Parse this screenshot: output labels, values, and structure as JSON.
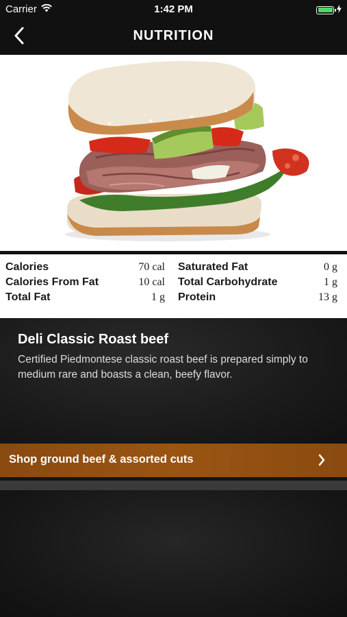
{
  "status_bar": {
    "carrier": "Carrier",
    "time": "1:42 PM",
    "battery_level": 1.0,
    "battery_color": "#4cd964"
  },
  "nav": {
    "back_icon": "chevron-left-icon",
    "title": "NUTRITION"
  },
  "hero": {
    "image_subject": "roast beef sandwich"
  },
  "nutrition": {
    "left": [
      {
        "label": "Calories",
        "value": "70 cal"
      },
      {
        "label": "Calories From Fat",
        "value": "10 cal"
      },
      {
        "label": "Total Fat",
        "value": "1 g"
      }
    ],
    "right": [
      {
        "label": "Saturated Fat",
        "value": "0 g"
      },
      {
        "label": "Total Carbohydrate",
        "value": "1 g"
      },
      {
        "label": "Protein",
        "value": "13 g"
      }
    ]
  },
  "product": {
    "name": "Deli Classic Roast beef",
    "description": "Certified Piedmontese classic roast beef is prepared simply to medium rare and boasts a clean, beefy flavor."
  },
  "shop": {
    "label": "Shop ground beef & assorted cuts",
    "chevron_icon": "chevron-right-icon",
    "accent_color": "#9a5512"
  }
}
